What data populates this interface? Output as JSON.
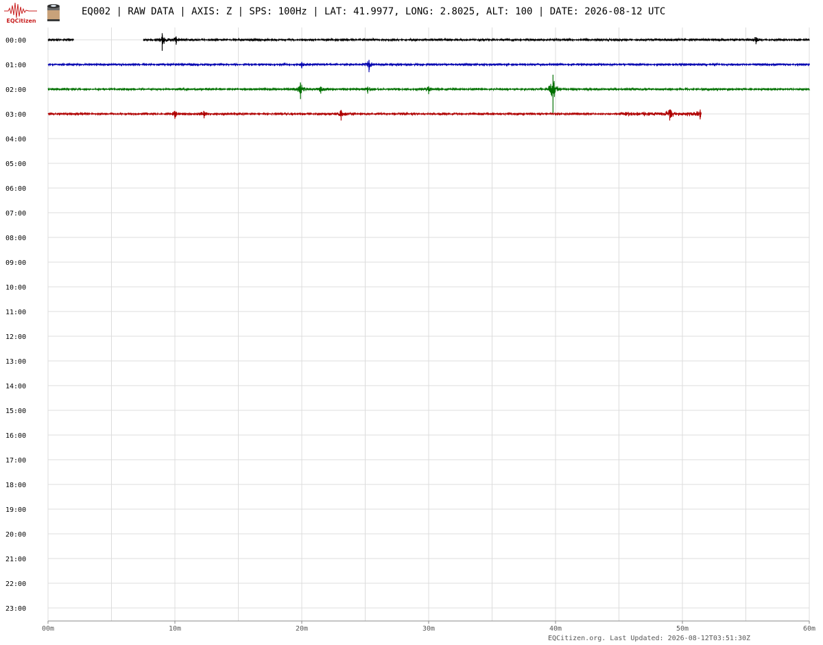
{
  "header": {
    "logo_text": "EQCitizen",
    "title": "EQ002 | RAW DATA | AXIS: Z | SPS: 100Hz | LAT: 41.9977, LONG: 2.8025, ALT: 100 | DATE: 2026-08-12 UTC"
  },
  "footer": {
    "updated": "EQCitizen.org. Last Updated: 2026-08-12T03:51:30Z"
  },
  "colors": {
    "trace_00": "#000000",
    "trace_01": "#0000b0",
    "trace_02": "#007000",
    "trace_03": "#b00000",
    "grid": "#dcdcdc",
    "logo": "#c81e1e"
  },
  "chart_data": {
    "type": "line",
    "title": "",
    "xlabel": "",
    "ylabel": "",
    "x_unit": "minutes",
    "xlim": [
      0,
      60
    ],
    "x_tick_labels": [
      "00m",
      "10m",
      "20m",
      "30m",
      "40m",
      "50m",
      "60m"
    ],
    "row_labels": [
      "00:00",
      "01:00",
      "02:00",
      "03:00",
      "04:00",
      "05:00",
      "06:00",
      "07:00",
      "08:00",
      "09:00",
      "10:00",
      "11:00",
      "12:00",
      "13:00",
      "14:00",
      "15:00",
      "16:00",
      "17:00",
      "18:00",
      "19:00",
      "20:00",
      "21:00",
      "22:00",
      "23:00"
    ],
    "grid": true,
    "legend": "none",
    "series": [
      {
        "row": "00:00",
        "color": "#000000",
        "segments": [
          [
            0,
            2
          ],
          [
            7.5,
            60
          ]
        ],
        "events": [
          {
            "minute": 9.0,
            "amp": 1.0
          },
          {
            "minute": 10.1,
            "amp": 0.45
          },
          {
            "minute": 55.8,
            "amp": 0.4
          }
        ]
      },
      {
        "row": "01:00",
        "color": "#0000b0",
        "segments": [
          [
            0,
            60
          ]
        ],
        "events": [
          {
            "minute": 25.3,
            "amp": 0.7
          },
          {
            "minute": 20.0,
            "amp": 0.35
          }
        ]
      },
      {
        "row": "02:00",
        "color": "#007000",
        "segments": [
          [
            0,
            60
          ]
        ],
        "events": [
          {
            "minute": 19.9,
            "amp": 0.9
          },
          {
            "minute": 39.8,
            "amp": 2.2
          },
          {
            "minute": 30.0,
            "amp": 0.45
          },
          {
            "minute": 25.2,
            "amp": 0.4
          },
          {
            "minute": 21.5,
            "amp": 0.4
          }
        ]
      },
      {
        "row": "03:00",
        "color": "#b00000",
        "segments": [
          [
            0,
            51.5
          ]
        ],
        "events": [
          {
            "minute": 23.1,
            "amp": 0.6
          },
          {
            "minute": 10.0,
            "amp": 0.45
          },
          {
            "minute": 12.3,
            "amp": 0.4
          },
          {
            "minute": 49.0,
            "amp": 0.6
          },
          {
            "minute": 51.4,
            "amp": 0.5
          }
        ]
      }
    ]
  }
}
